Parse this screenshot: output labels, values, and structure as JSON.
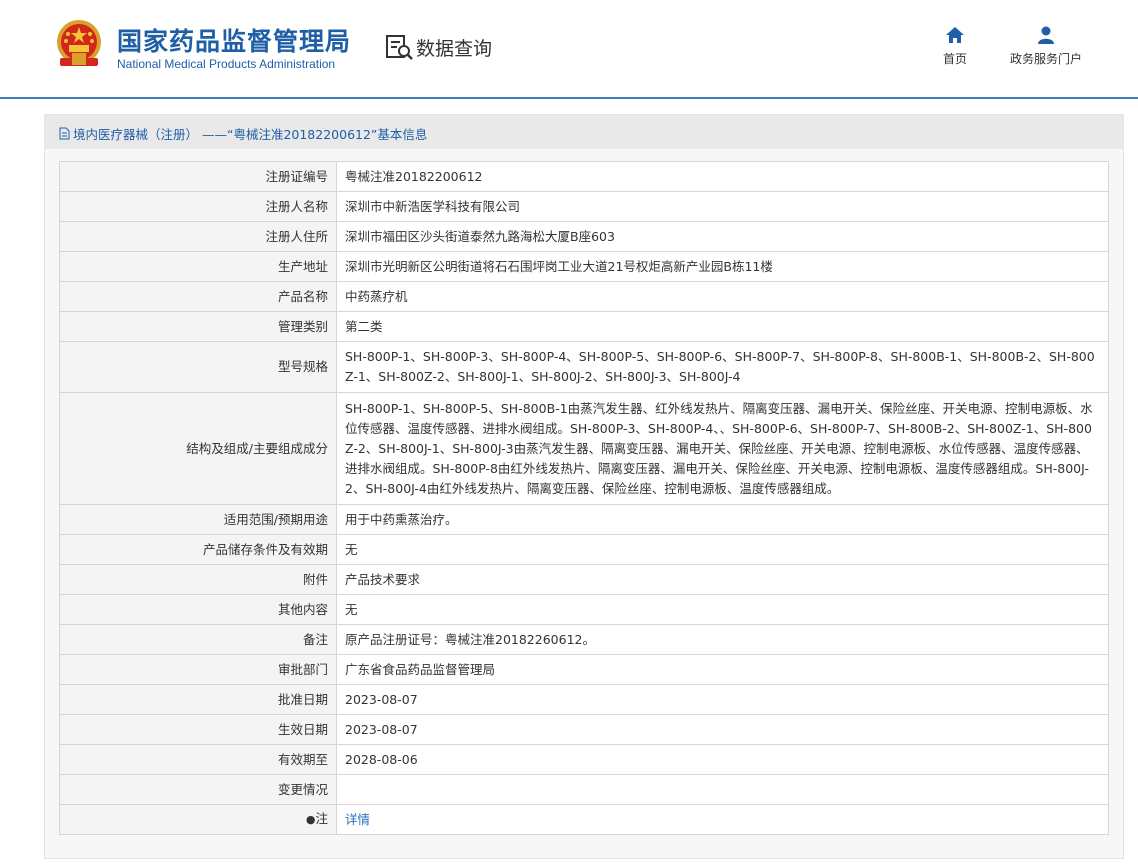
{
  "header": {
    "brand_cn": "国家药品监督管理局",
    "brand_en": "National Medical Products Administration",
    "query_title": "数据查询",
    "nav": [
      {
        "label": "首页",
        "icon": "home-icon"
      },
      {
        "label": "政务服务门户",
        "icon": "user-icon"
      }
    ],
    "accent_color": "#1e5fa8"
  },
  "panel": {
    "title": "境内医疗器械（注册） ——“粤械注准20182200612”基本信息"
  },
  "rows": [
    {
      "key": "注册证编号",
      "value": "粤械注准20182200612"
    },
    {
      "key": "注册人名称",
      "value": "深圳市中新浩医学科技有限公司"
    },
    {
      "key": "注册人住所",
      "value": "深圳市福田区沙头街道泰然九路海松大厦B座603"
    },
    {
      "key": "生产地址",
      "value": "深圳市光明新区公明街道将石石围坪岗工业大道21号权炬高新产业园B栋11楼"
    },
    {
      "key": "产品名称",
      "value": "中药蒸疗机"
    },
    {
      "key": "管理类别",
      "value": "第二类"
    },
    {
      "key": "型号规格",
      "value": "SH-800P-1、SH-800P-3、SH-800P-4、SH-800P-5、SH-800P-6、SH-800P-7、SH-800P-8、SH-800B-1、SH-800B-2、SH-800Z-1、SH-800Z-2、SH-800J-1、SH-800J-2、SH-800J-3、SH-800J-4"
    },
    {
      "key": "结构及组成/主要组成成分",
      "value": "SH-800P-1、SH-800P-5、SH-800B-1由蒸汽发生器、红外线发热片、隔离变压器、漏电开关、保险丝座、开关电源、控制电源板、水位传感器、温度传感器、进排水阀组成。SH-800P-3、SH-800P-4、、SH-800P-6、SH-800P-7、SH-800B-2、SH-800Z-1、SH-800Z-2、SH-800J-1、SH-800J-3由蒸汽发生器、隔离变压器、漏电开关、保险丝座、开关电源、控制电源板、水位传感器、温度传感器、进排水阀组成。SH-800P-8由红外线发热片、隔离变压器、漏电开关、保险丝座、开关电源、控制电源板、温度传感器组成。SH-800J-2、SH-800J-4由红外线发热片、隔离变压器、保险丝座、控制电源板、温度传感器组成。"
    },
    {
      "key": "适用范围/预期用途",
      "value": "用于中药熏蒸治疗。"
    },
    {
      "key": "产品储存条件及有效期",
      "value": "无"
    },
    {
      "key": "附件",
      "value": "产品技术要求"
    },
    {
      "key": "其他内容",
      "value": "无"
    },
    {
      "key": "备注",
      "value": "原产品注册证号：粤械注准20182260612。"
    },
    {
      "key": "审批部门",
      "value": "广东省食品药品监督管理局"
    },
    {
      "key": "批准日期",
      "value": "2023-08-07"
    },
    {
      "key": "生效日期",
      "value": "2023-08-07"
    },
    {
      "key": "有效期至",
      "value": "2028-08-06"
    },
    {
      "key": "变更情况",
      "value": ""
    },
    {
      "key": "注",
      "value": "详情"
    }
  ]
}
